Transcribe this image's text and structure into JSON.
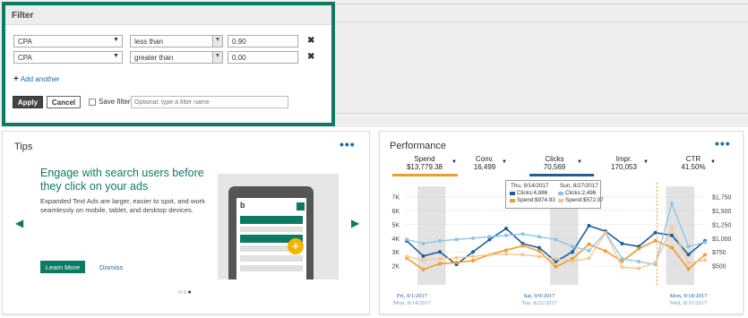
{
  "filter": {
    "title": "Filter",
    "rows": [
      {
        "field": "CPA",
        "operator": "less than",
        "value": "0.90"
      },
      {
        "field": "CPA",
        "operator": "greater than",
        "value": "0.00"
      }
    ],
    "add_another": "Add another",
    "apply": "Apply",
    "cancel": "Cancel",
    "save_filter": "Save filter",
    "filter_name_placeholder": "Optional: type a filter name",
    "remove_glyph": "✖"
  },
  "tips": {
    "title": "Tips",
    "headline": "Engage with search users before they click on your ads",
    "body": "Expanded Text Ads are larger, easier to spot, and work seamlessly on mobile, tablet, and desktop devices.",
    "learn_more": "Learn More",
    "dismiss": "Dismiss",
    "more": "•••",
    "prev": "◀",
    "next": "▶",
    "brand_glyph": "b",
    "plus_glyph": "+",
    "pager": [
      "○",
      "○",
      "●"
    ]
  },
  "performance": {
    "title": "Performance",
    "more": "•••",
    "metrics": [
      {
        "name": "Spend",
        "value": "$13,779.38",
        "color": "#f39c2b"
      },
      {
        "name": "Conv.",
        "value": "16,499"
      },
      {
        "name": "Clicks",
        "value": "70,569",
        "color": "#1a5fa0"
      },
      {
        "name": "Impr.",
        "value": "170,053"
      },
      {
        "name": "CTR",
        "value": "41.50%"
      }
    ],
    "tooltip": {
      "date_a": "Thu, 9/14/2017",
      "date_b": "Sun, 8/27/2017",
      "clicks_a": "Clicks:4,886",
      "clicks_b": "Clicks:2,496",
      "spend_a": "Spend:$974.93",
      "spend_b": "Spend:$572.07"
    }
  },
  "chart_data": {
    "type": "line",
    "title": "",
    "y_left_ticks": [
      "7K",
      "6K",
      "5K",
      "4K",
      "3K",
      "2K"
    ],
    "y_right_ticks": [
      "$1,750",
      "$1,500",
      "$1,250",
      "$1,000",
      "$750",
      "$500"
    ],
    "ylim_left": [
      1000,
      7500
    ],
    "ylim_right": [
      375,
      1875
    ],
    "x_labels": [
      {
        "top": "Fri, 9/1/2017",
        "bottom": "Mon, 8/14/2017"
      },
      {
        "top": "Sat, 9/9/2017",
        "bottom": "Tue, 8/22/2017"
      },
      {
        "top": "Mon, 9/18/2017",
        "bottom": "Wed, 8/31/2017"
      }
    ],
    "weekend_bands": [
      [
        1,
        2
      ],
      [
        9,
        10
      ],
      [
        16,
        17
      ]
    ],
    "series": [
      {
        "name": "Clicks",
        "axis": "left",
        "color": "#1a5fa0",
        "values": [
          3800,
          2700,
          3000,
          2100,
          3000,
          3900,
          4700,
          3600,
          3300,
          2300,
          3000,
          4900,
          4500,
          3600,
          3400,
          4400,
          4200,
          2800,
          3800
        ]
      },
      {
        "name": "Spend",
        "axis": "right",
        "color": "#f39c2b",
        "values": [
          735,
          540,
          640,
          660,
          690,
          790,
          865,
          940,
          850,
          590,
          720,
          965,
          850,
          680,
          890,
          1025,
          910,
          550,
          790
        ]
      },
      {
        "name": "Clicks",
        "axis": "left",
        "color": "#8cc4e8",
        "values": [
          3900,
          3600,
          3800,
          3900,
          4000,
          4100,
          4200,
          4300,
          4100,
          3900,
          3400,
          3100,
          4400,
          2500,
          2300,
          2100,
          6500,
          3400,
          3700
        ]
      },
      {
        "name": "Spend",
        "axis": "right",
        "color": "#f7c690",
        "values": [
          760,
          700,
          720,
          740,
          760,
          790,
          800,
          790,
          760,
          720,
          680,
          730,
          1150,
          580,
          560,
          660,
          1250,
          650,
          700
        ]
      }
    ],
    "grid": true,
    "marker_index": 15
  }
}
